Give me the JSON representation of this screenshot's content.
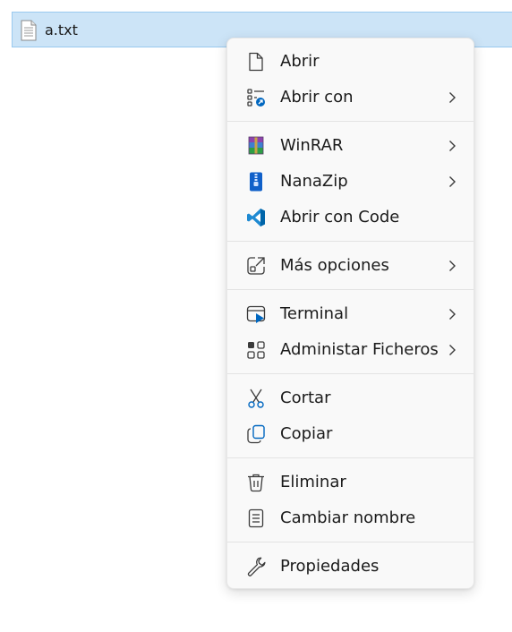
{
  "file": {
    "name": "a.txt",
    "icon": "text-file-icon"
  },
  "menu": {
    "groups": [
      [
        {
          "label": "Abrir",
          "icon": "open-file-icon",
          "submenu": false
        },
        {
          "label": "Abrir con",
          "icon": "open-with-icon",
          "submenu": true
        }
      ],
      [
        {
          "label": "WinRAR",
          "icon": "winrar-icon",
          "submenu": true
        },
        {
          "label": "NanaZip",
          "icon": "nanazip-icon",
          "submenu": true
        },
        {
          "label": "Abrir con Code",
          "icon": "vscode-icon",
          "submenu": false
        }
      ],
      [
        {
          "label": "Más opciones",
          "icon": "more-options-icon",
          "submenu": true
        }
      ],
      [
        {
          "label": "Terminal",
          "icon": "terminal-icon",
          "submenu": true
        },
        {
          "label": "Administar Ficheros",
          "icon": "manage-files-icon",
          "submenu": true
        }
      ],
      [
        {
          "label": "Cortar",
          "icon": "scissors-icon",
          "submenu": false
        },
        {
          "label": "Copiar",
          "icon": "copy-icon",
          "submenu": false
        }
      ],
      [
        {
          "label": "Eliminar",
          "icon": "trash-icon",
          "submenu": false
        },
        {
          "label": "Cambiar nombre",
          "icon": "rename-icon",
          "submenu": false
        }
      ],
      [
        {
          "label": "Propiedades",
          "icon": "wrench-icon",
          "submenu": false
        }
      ]
    ]
  },
  "colors": {
    "selection_bg": "#cce4f7",
    "selection_border": "#99c9ef",
    "menu_bg": "#f9f9f9",
    "accent_blue": "#0067c0"
  }
}
